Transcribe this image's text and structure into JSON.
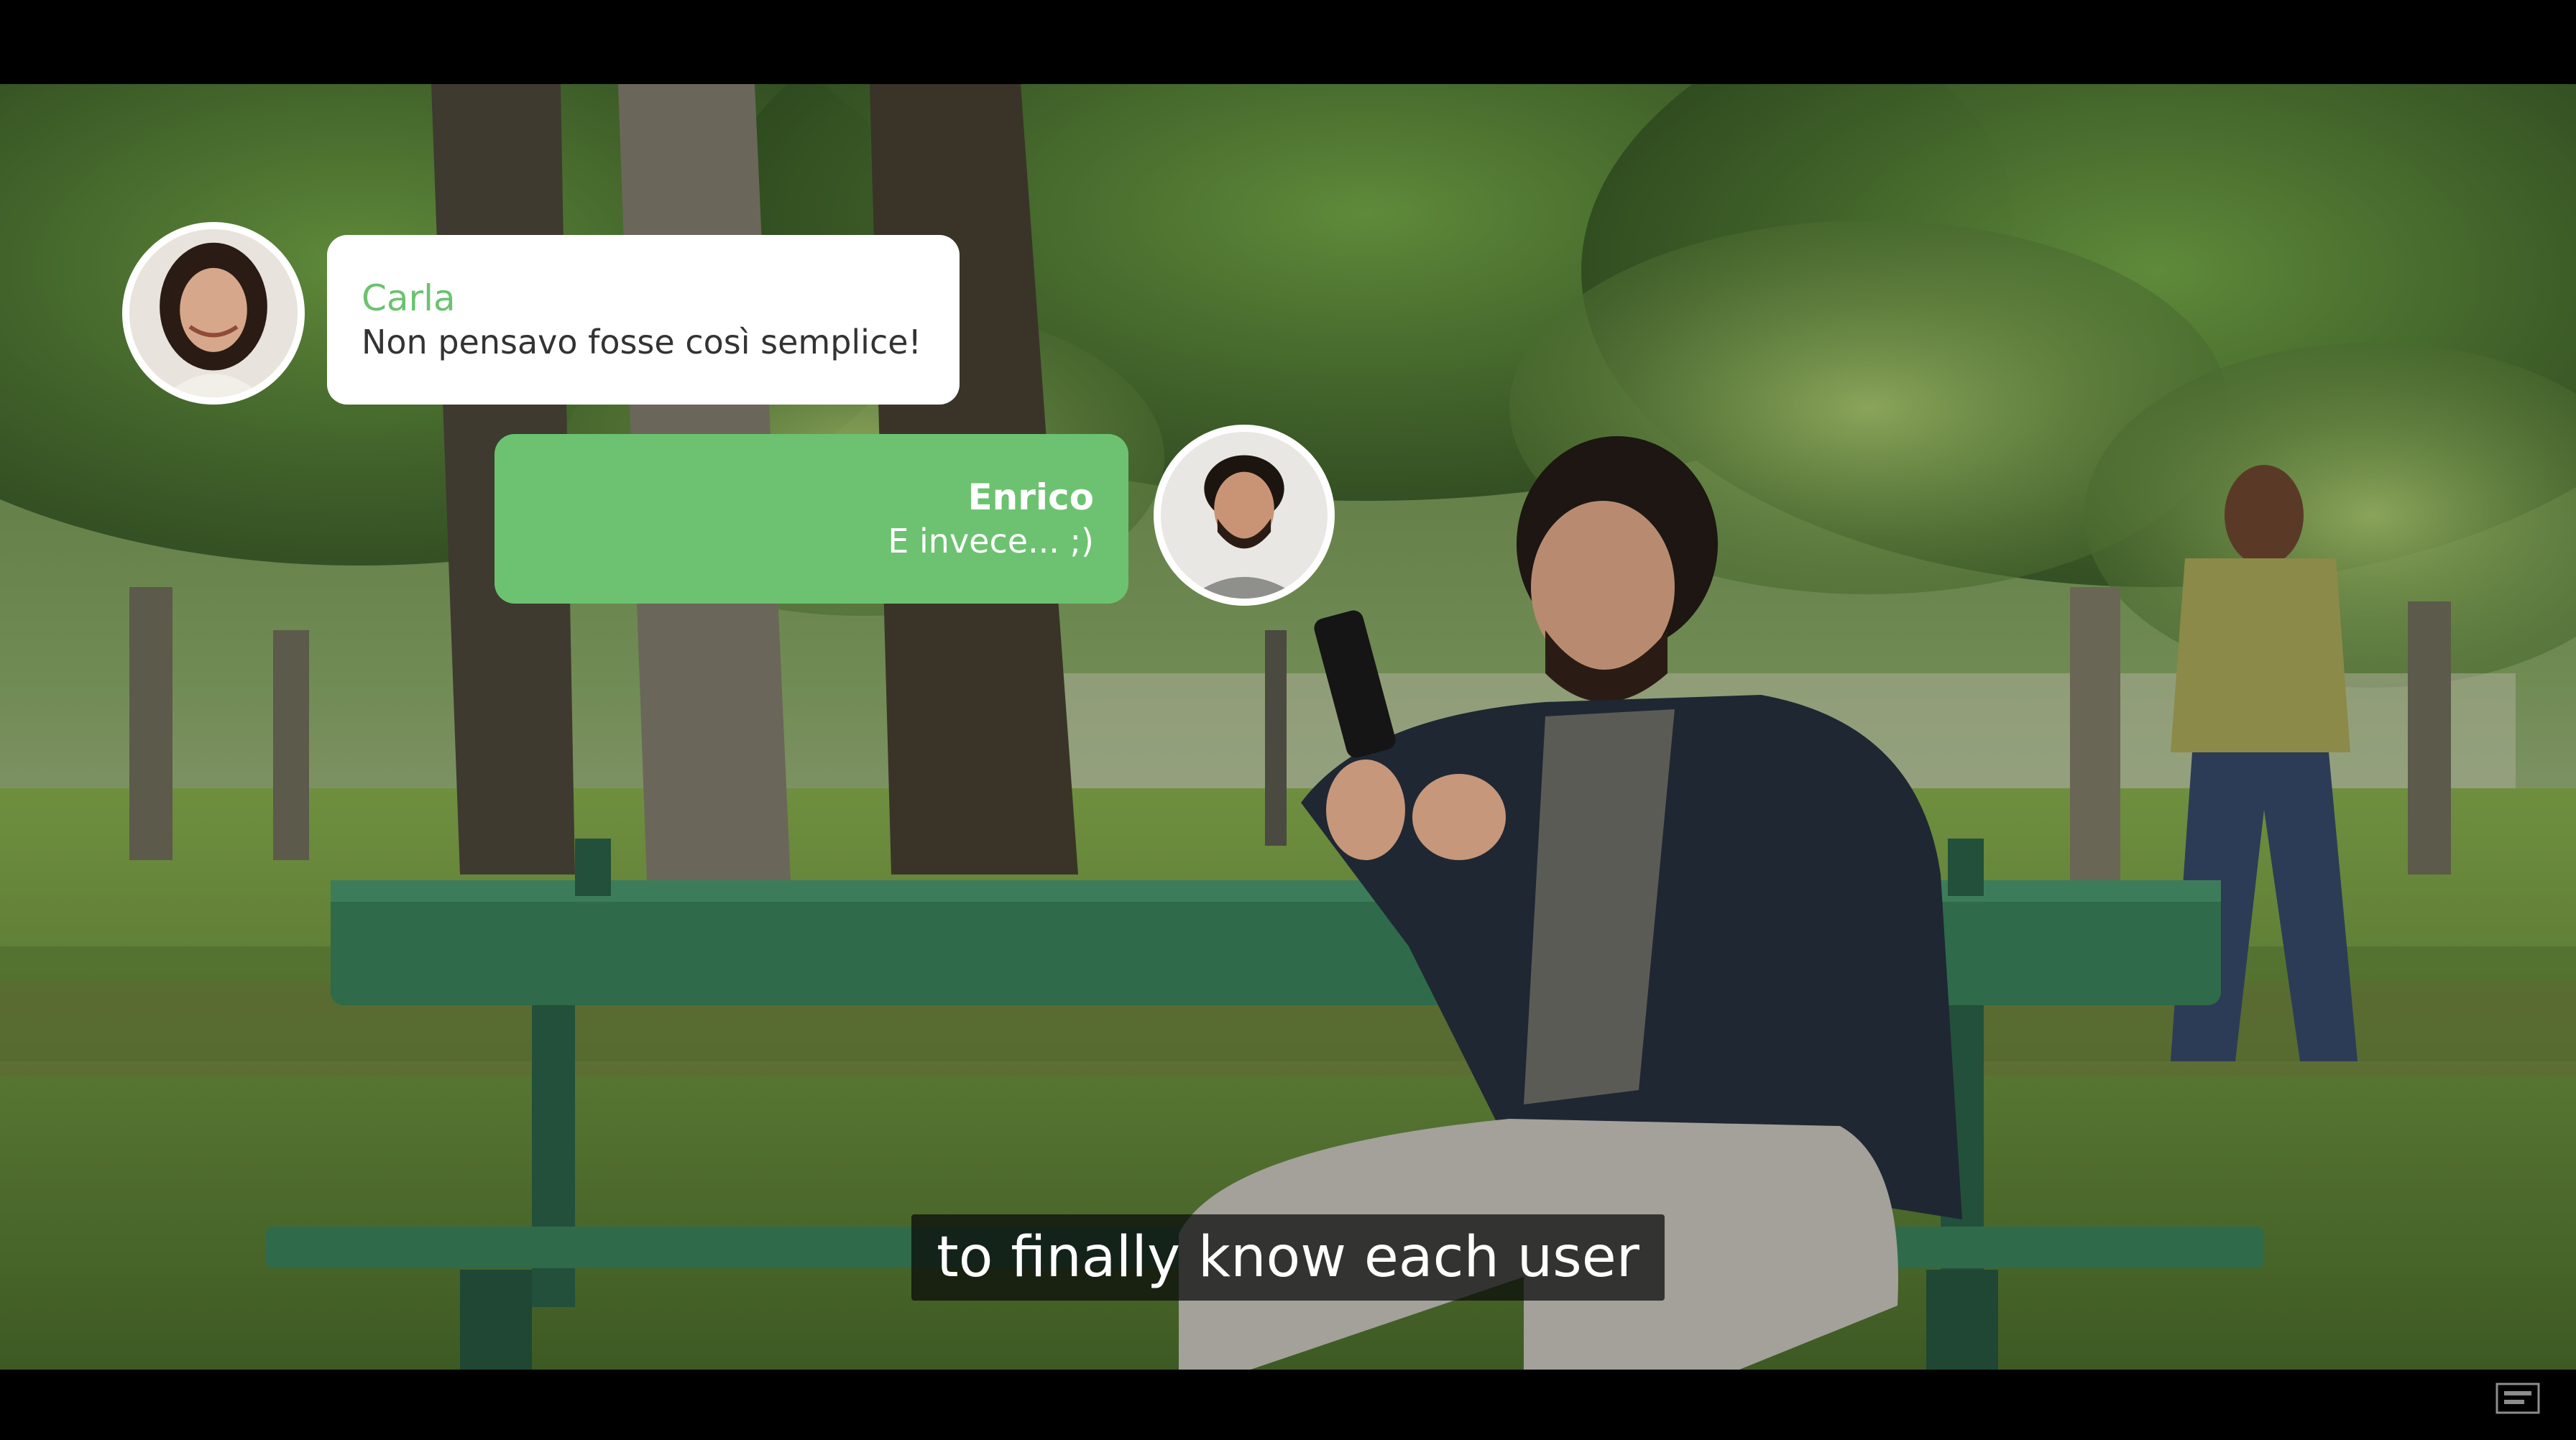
{
  "chat": {
    "carla": {
      "sender": "Carla",
      "message": "Non pensavo fosse così semplice!",
      "accent_color": "#6cc270"
    },
    "enrico": {
      "sender": "Enrico",
      "message": "E invece... ;)",
      "bubble_color": "#6cc270"
    }
  },
  "subtitle": {
    "text": "to finally know each user"
  },
  "icons": {
    "carla_avatar": "woman-portrait-avatar",
    "enrico_avatar": "man-portrait-avatar",
    "channel_watermark": "channel-logo-watermark"
  }
}
